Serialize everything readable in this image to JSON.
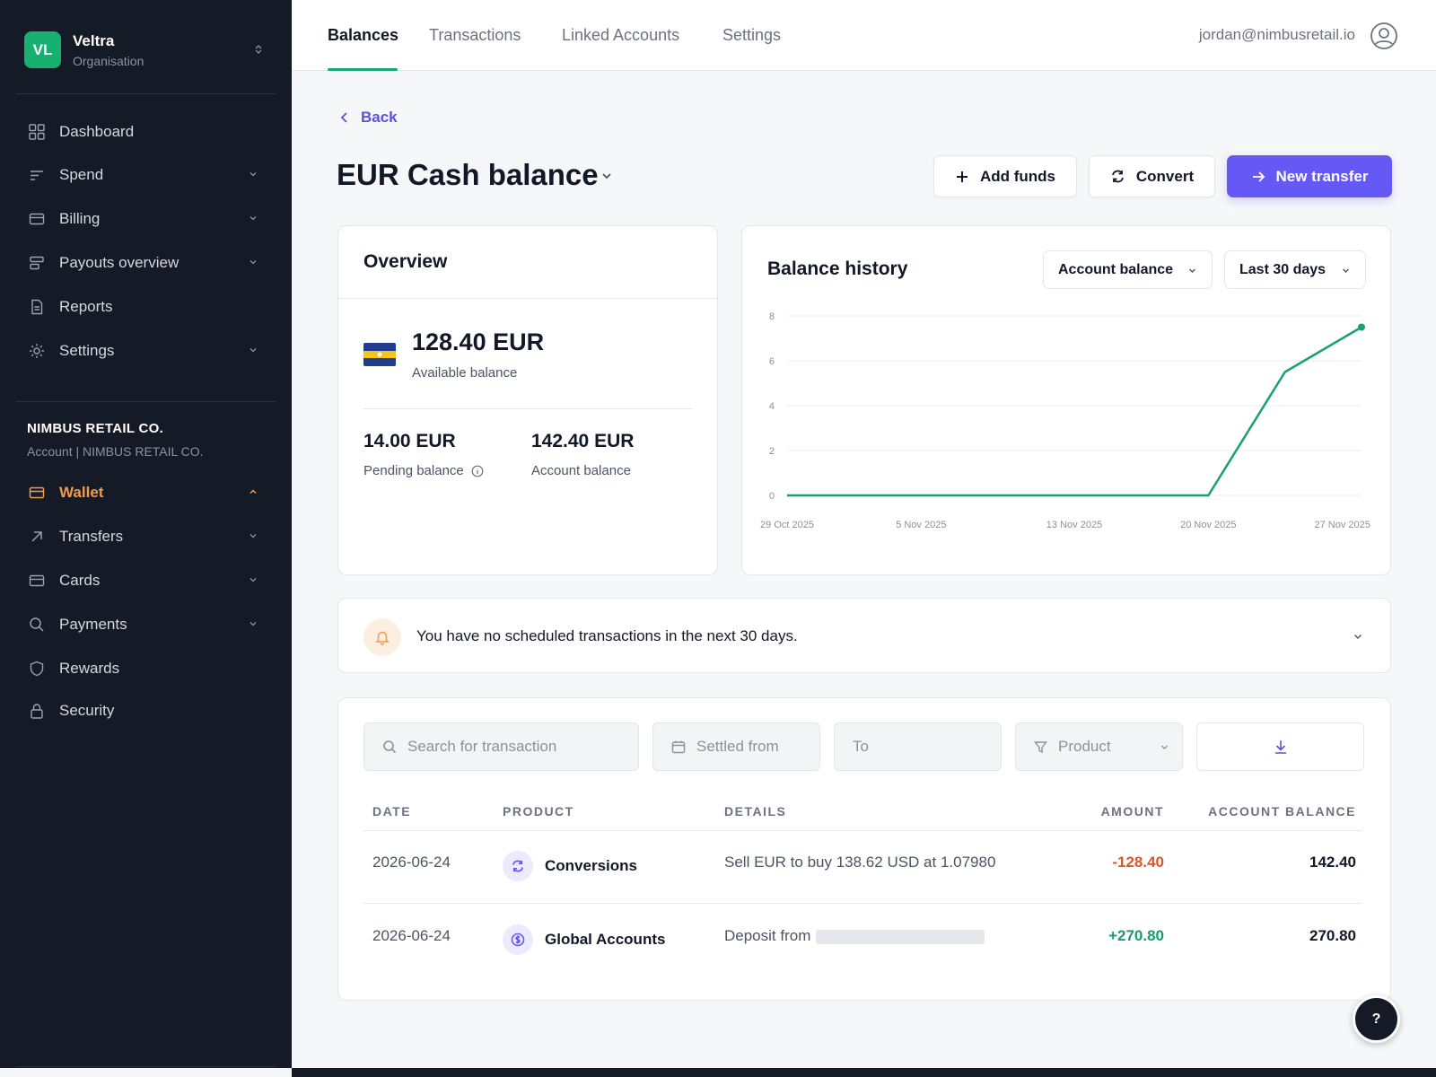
{
  "org": {
    "initials": "VL",
    "name": "Veltra",
    "subtitle": "Organisation"
  },
  "sidebar": {
    "items": [
      {
        "label": "Dashboard",
        "icon": "grid-icon",
        "has_chevron": false
      },
      {
        "label": "Spend",
        "icon": "bars-icon",
        "has_chevron": true
      },
      {
        "label": "Billing",
        "icon": "card-icon",
        "has_chevron": true
      },
      {
        "label": "Payouts overview",
        "icon": "payouts-icon",
        "has_chevron": true
      },
      {
        "label": "Reports",
        "icon": "document-icon",
        "has_chevron": false
      },
      {
        "label": "Settings",
        "icon": "gear-icon",
        "has_chevron": true
      }
    ],
    "account": {
      "name": "NIMBUS RETAIL CO.",
      "subtitle": "Account | NIMBUS RETAIL CO."
    },
    "account_items": [
      {
        "label": "Wallet",
        "icon": "wallet-icon",
        "active": true
      },
      {
        "label": "Transfers",
        "icon": "arrow-up-right-icon"
      },
      {
        "label": "Cards",
        "icon": "card-icon"
      },
      {
        "label": "Payments",
        "icon": "search-icon"
      },
      {
        "label": "Rewards",
        "icon": "shield-icon"
      },
      {
        "label": "Security",
        "icon": "lock-icon"
      }
    ]
  },
  "topnav": {
    "tabs": [
      "Balances",
      "Transactions",
      "Linked Accounts",
      "Settings"
    ],
    "active_tab": "Balances",
    "user_email": "jordan@nimbusretail.io"
  },
  "page": {
    "back_label": "Back",
    "title": "EUR Cash balance",
    "actions": {
      "add_funds": "Add funds",
      "convert": "Convert",
      "new_transfer": "New transfer"
    }
  },
  "overview": {
    "title": "Overview",
    "available_amount": "128.40 EUR",
    "available_label": "Available balance",
    "pending_amount": "14.00 EUR",
    "pending_label": "Pending balance",
    "account_amount": "142.40 EUR",
    "account_label": "Account balance"
  },
  "balance_history": {
    "title": "Balance history",
    "metric_select": "Account balance",
    "range_select": "Last 30 days"
  },
  "chart_data": {
    "type": "line",
    "x": [
      "29 Oct 2025",
      "20 Nov 2025",
      "24 Nov 2025",
      "28 Nov 2025"
    ],
    "x_tick_labels": [
      "29 Oct 2025",
      "5 Nov 2025",
      "13 Nov 2025",
      "20 Nov 2025",
      "27 Nov 2025"
    ],
    "series": [
      {
        "values": [
          0,
          0,
          5.5,
          7.5
        ]
      }
    ],
    "ylim": [
      0,
      8
    ],
    "y_ticks": [
      0,
      2,
      4,
      6,
      8
    ],
    "grid": true,
    "line_color": "#19a06f"
  },
  "scheduled": {
    "message": "You have no scheduled transactions in the next 30 days."
  },
  "filters": {
    "search_placeholder": "Search for transaction",
    "settled_from_placeholder": "Settled from",
    "to_placeholder": "To",
    "product_placeholder": "Product"
  },
  "table": {
    "headers": {
      "date": "DATE",
      "product": "PRODUCT",
      "details": "DETAILS",
      "amount": "AMOUNT",
      "balance": "ACCOUNT BALANCE"
    },
    "rows": [
      {
        "date": "2026-06-24",
        "product": "Conversions",
        "product_icon": "convert-icon",
        "details": "Sell EUR to buy 138.62 USD at 1.07980",
        "amount": "-128.40",
        "amount_color": "#e0522a",
        "balance": "142.40"
      },
      {
        "date": "2026-06-24",
        "product": "Global Accounts",
        "product_icon": "currency-icon",
        "details": "Deposit from",
        "amount": "+270.80",
        "amount_color": "#1a9a6a",
        "balance": "270.80"
      }
    ]
  },
  "help": {
    "label": "?"
  },
  "colors": {
    "accent": "#6558f5",
    "sidebar_bg": "#141a26",
    "active_nav": "#f2994a",
    "brand_green": "#18b070"
  }
}
